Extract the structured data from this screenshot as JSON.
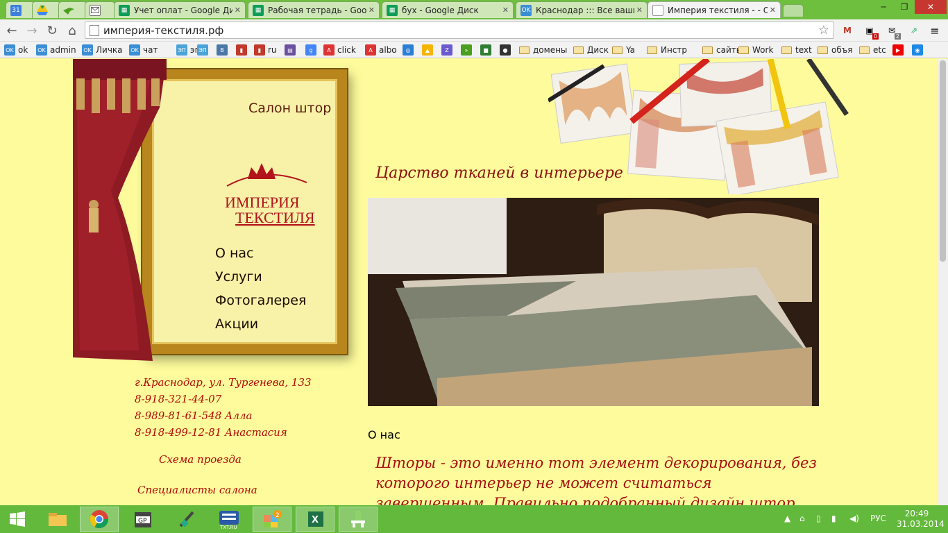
{
  "tabs": [
    {
      "icon": "calendar-icon",
      "icon_text": "31",
      "title": ""
    },
    {
      "icon": "drive-icon",
      "icon_text": "",
      "title": ""
    },
    {
      "icon": "bird-icon",
      "icon_text": "",
      "title": ""
    },
    {
      "icon": "mail-icon",
      "icon_text": "",
      "title": ""
    },
    {
      "icon": "sheets-icon",
      "icon_text": "",
      "title": "Учет оплат - Google Диск"
    },
    {
      "icon": "sheets-icon",
      "icon_text": "",
      "title": "Рабочая тетрадь - Google"
    },
    {
      "icon": "sheets-icon",
      "icon_text": "",
      "title": "бух - Google Диск"
    },
    {
      "icon": "ok-icon",
      "icon_text": "OK",
      "title": "Краснодар ::: Все ваши в"
    },
    {
      "icon": "page-icon",
      "icon_text": "",
      "title": "Империя текстиля - - О н"
    }
  ],
  "url": "империя-текстиля.рф",
  "bookmarks": [
    {
      "icon": "ok-icon",
      "label": "ok"
    },
    {
      "icon": "ok-icon",
      "label": "admin"
    },
    {
      "icon": "ok-icon",
      "label": "Личка"
    },
    {
      "icon": "ok-icon",
      "label": "чат"
    },
    {
      "icon": "ep-icon",
      "label": "эп"
    },
    {
      "icon": "ep-icon",
      "label": ""
    },
    {
      "icon": "vk-icon",
      "label": ""
    },
    {
      "icon": "stats-icon",
      "label": ""
    },
    {
      "icon": "stats-icon",
      "label": "ru"
    },
    {
      "icon": "bookmark-icon",
      "label": ""
    },
    {
      "icon": "google-icon",
      "label": ""
    },
    {
      "icon": "adwords-icon",
      "label": "click"
    },
    {
      "icon": "adwords-icon",
      "label": "albo"
    },
    {
      "icon": "globe-icon",
      "label": ""
    },
    {
      "icon": "drive-icon",
      "label": ""
    },
    {
      "icon": "zip-icon",
      "label": ""
    },
    {
      "icon": "bird-icon",
      "label": ""
    },
    {
      "icon": "green-app-icon",
      "label": ""
    },
    {
      "icon": "camera-icon",
      "label": ""
    },
    {
      "icon": "folder-icon",
      "label": "домены"
    },
    {
      "icon": "folder-icon",
      "label": "Диск"
    },
    {
      "icon": "folder-icon",
      "label": "Ya"
    },
    {
      "icon": "folder-icon",
      "label": "Инстр"
    },
    {
      "icon": "folder-icon",
      "label": "сайты"
    },
    {
      "icon": "folder-icon",
      "label": "Work"
    },
    {
      "icon": "folder-icon",
      "label": "text"
    },
    {
      "icon": "folder-icon",
      "label": "объя"
    },
    {
      "icon": "folder-icon",
      "label": "etc"
    },
    {
      "icon": "youtube-icon",
      "label": ""
    },
    {
      "icon": "target-icon",
      "label": ""
    }
  ],
  "site": {
    "salon": "Салон штор",
    "logo_line1": "ИМПЕРИЯ",
    "logo_line2": "ТЕКСТИЛЯ",
    "menu": [
      "О нас",
      "Услуги",
      "Фотогалерея",
      "Акции"
    ],
    "address": "г.Краснодар, ул. Тургенева, 133",
    "phone1": "8-918-321-44-07",
    "phone2": "8-989-81-61-548 Алла",
    "phone3": "8-918-499-12-81 Анастасия",
    "map_link": "Схема проезда",
    "specialists": "Специалисты салона",
    "slogan": "Царство тканей в интерьере",
    "section_title": "О нас",
    "intro": "Шторы - это именно тот элемент декорирования, без которого интерьер не может считаться завершенным. Правильно подобранный дизайн штор подчеркнёт"
  },
  "ext": {
    "mail_badge": "0",
    "msg_badge": "2"
  },
  "taskbar": {
    "items": [
      "explorer-icon",
      "chrome-icon",
      "gp-icon",
      "pen-icon",
      "txt-icon",
      "game-icon",
      "excel-icon",
      "app-icon"
    ],
    "lang": "РУС",
    "time": "20:49",
    "date": "31.03.2014"
  },
  "colors": {
    "page_bg": "#fdfb9b",
    "taskbar": "#63b93b",
    "accent_red": "#b10808"
  }
}
